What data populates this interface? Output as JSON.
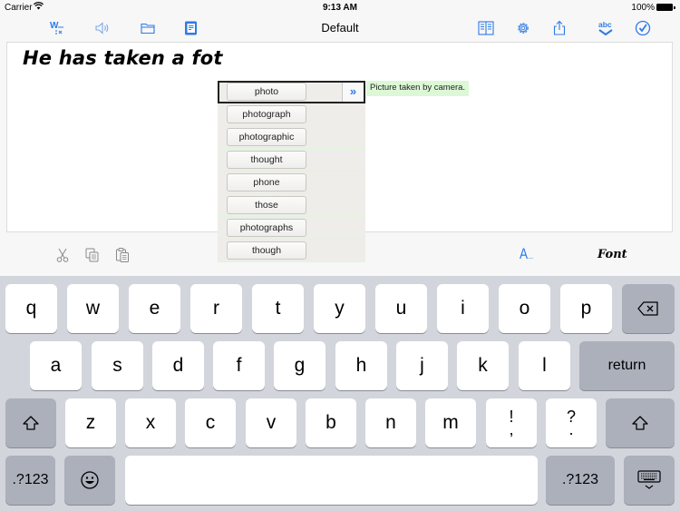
{
  "status_bar": {
    "carrier": "Carrier",
    "wifi_icon": "wifi-icon",
    "time": "9:13 AM",
    "battery": "100%"
  },
  "toolbar": {
    "title": "Default",
    "left_icons": [
      "word-prediction-icon",
      "speaker-icon",
      "folder-icon",
      "notebook-icon"
    ],
    "right_icons": [
      "reader-view-icon",
      "gear-icon",
      "share-icon",
      "spellcheck-icon",
      "checkmark-circle-icon"
    ]
  },
  "editor": {
    "text": "He has taken a fot"
  },
  "suggestions": {
    "selected_index": 0,
    "items": [
      "photo",
      "photograph",
      "photographic",
      "thought",
      "phone",
      "those",
      "photographs",
      "though"
    ],
    "more_label": "»",
    "definition": "Picture taken by camera.",
    "accent_color": "#2e7be6",
    "definition_bg": "#dcf8d6"
  },
  "edit_bar": {
    "icons": [
      "cut-icon",
      "copy-icon",
      "paste-icon"
    ],
    "font_style_label": "A",
    "font_style_suffix": "...",
    "font_label": "Font"
  },
  "keyboard": {
    "row1": [
      "q",
      "w",
      "e",
      "r",
      "t",
      "y",
      "u",
      "i",
      "o",
      "p"
    ],
    "row2": [
      "a",
      "s",
      "d",
      "f",
      "g",
      "h",
      "j",
      "k",
      "l"
    ],
    "row3": [
      "z",
      "x",
      "c",
      "v",
      "b",
      "n",
      "m"
    ],
    "punct1": {
      "top": "!",
      "bottom": ","
    },
    "punct2": {
      "top": "?",
      "bottom": "."
    },
    "return_label": "return",
    "numbers_label": ".?123",
    "space_label": ""
  }
}
